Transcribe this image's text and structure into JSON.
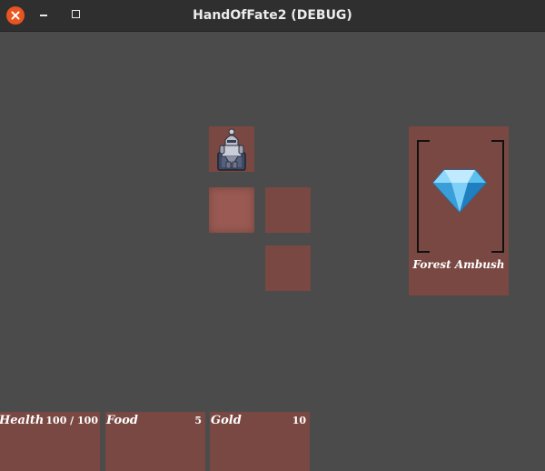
{
  "window": {
    "title": "HandOfFate2 (DEBUG)"
  },
  "map": {
    "player_icon": "knight-icon",
    "tiles": [
      "player-tile",
      "current-tile",
      "tile",
      "tile"
    ]
  },
  "card": {
    "name": "Forest Ambush",
    "icon": "diamond-icon"
  },
  "stats": {
    "health": {
      "label": "Health",
      "value": "100 / 100"
    },
    "food": {
      "label": "Food",
      "value": "5"
    },
    "gold": {
      "label": "Gold",
      "value": "10"
    }
  },
  "colors": {
    "background": "#4b4b4b",
    "titlebar": "#2f2f2f",
    "tile": "#7a4842",
    "tile_active": "#9a5a53",
    "close_button": "#e9541f"
  }
}
